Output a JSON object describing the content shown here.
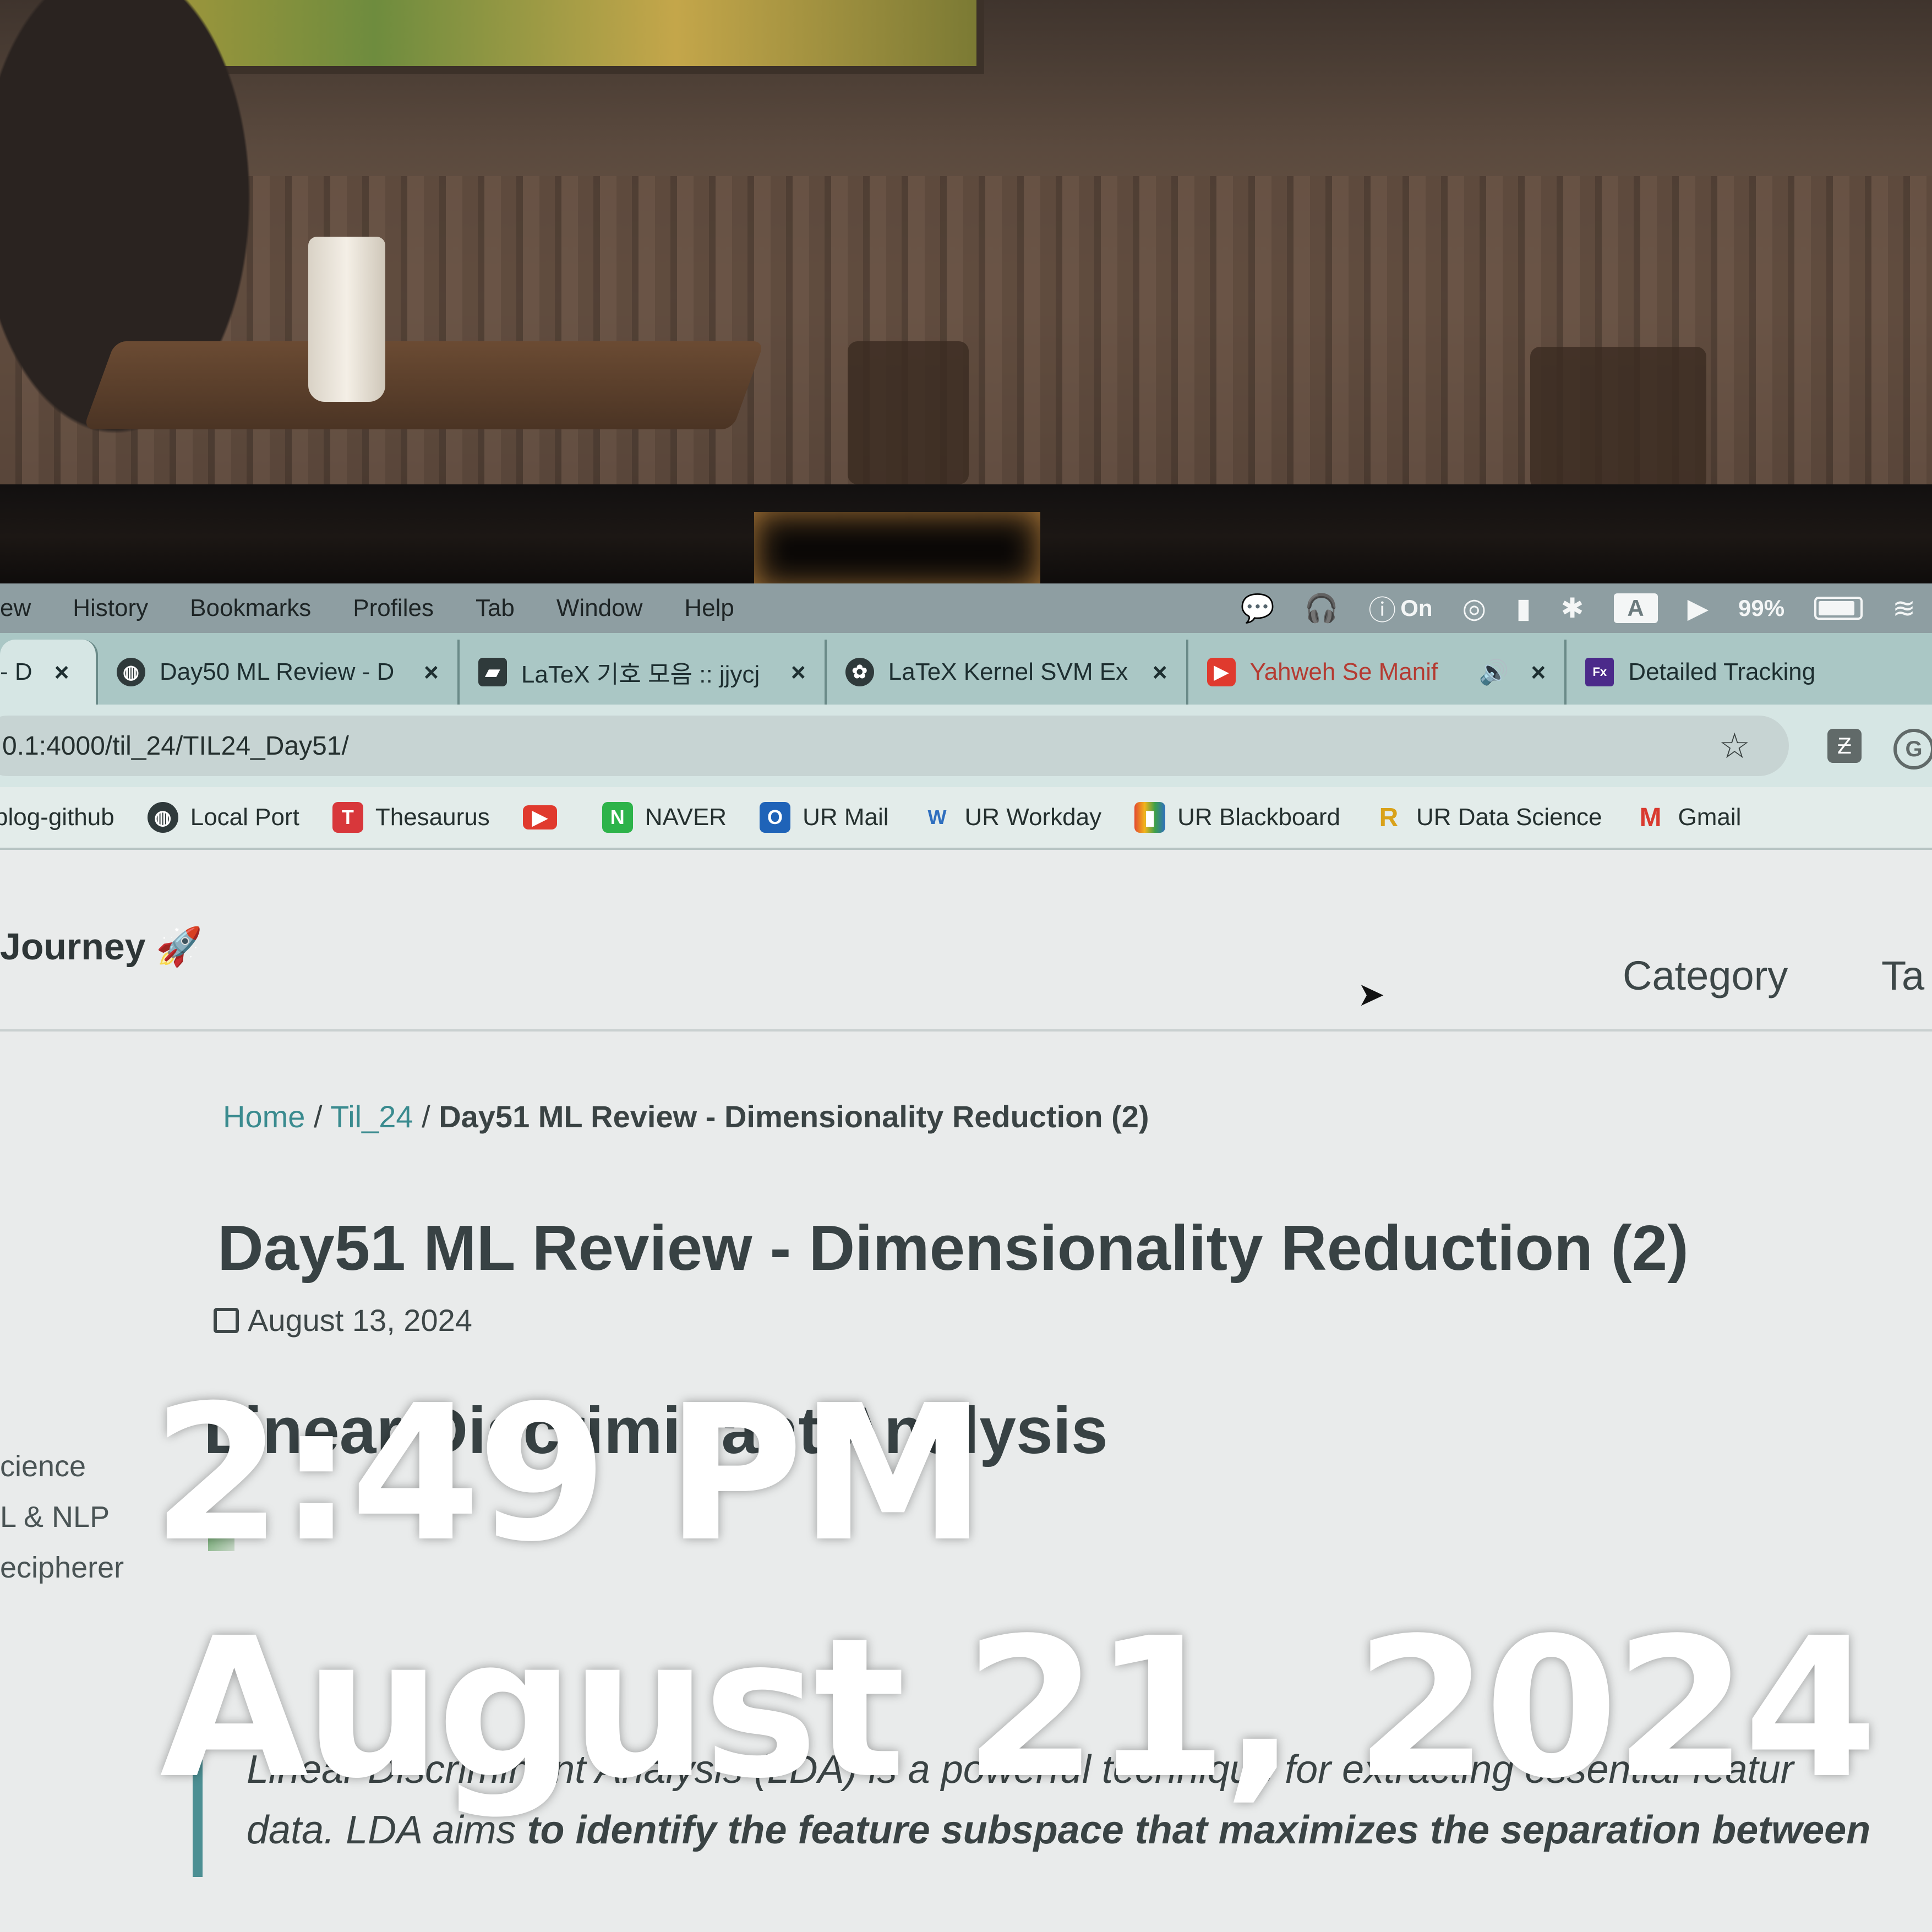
{
  "menubar": {
    "items": [
      "ew",
      "History",
      "Bookmarks",
      "Profiles",
      "Tab",
      "Window",
      "Help"
    ],
    "status": {
      "energy": "On",
      "battery": "99%"
    }
  },
  "tabs": [
    {
      "title": "- D",
      "favicon": "globe-icon"
    },
    {
      "title": "Day50 ML Review - D",
      "favicon": "globe-icon"
    },
    {
      "title": "LaTeX 기호 모음 :: jjycj",
      "favicon": "chat-icon"
    },
    {
      "title": "LaTeX Kernel SVM Ex",
      "favicon": "openai-icon"
    },
    {
      "title": "Yahweh Se Manif",
      "favicon": "youtube-icon"
    },
    {
      "title": "Detailed Tracking",
      "favicon": "fedex-icon"
    }
  ],
  "omnibox": {
    "url": "0.1:4000/til_24/TIL24_Day51/"
  },
  "bookmarks": [
    {
      "label": "blog-github"
    },
    {
      "label": "Local Port"
    },
    {
      "label": "Thesaurus"
    },
    {
      "label": ""
    },
    {
      "label": "NAVER"
    },
    {
      "label": "UR Mail"
    },
    {
      "label": "UR Workday"
    },
    {
      "label": "UR Blackboard"
    },
    {
      "label": "UR Data Science"
    },
    {
      "label": "Gmail"
    }
  ],
  "site": {
    "title": "Journey 🚀",
    "nav": [
      "Category",
      "Ta"
    ]
  },
  "breadcrumb": {
    "home": "Home",
    "section": "Til_24",
    "current": "Day51 ML Review - Dimensionality Reduction (2)"
  },
  "post": {
    "title": "Day51 ML Review - Dimensionality Reduction (2)",
    "date": "August 13, 2024",
    "section_heading": "Linear Discriminant Analysis",
    "paragraph_line1": "Linear Discriminant Analysis (LDA) is a powerful technique for extracting essential featur",
    "paragraph_line2_prefix": "data. LDA aims ",
    "paragraph_line2_bold": "to identify the feature subspace that maximizes the separation between"
  },
  "sidebar": [
    "cience",
    "L & NLP",
    "ecipherer"
  ],
  "overlay": {
    "time": "2:49 PM",
    "date": "August 21, 2024"
  }
}
